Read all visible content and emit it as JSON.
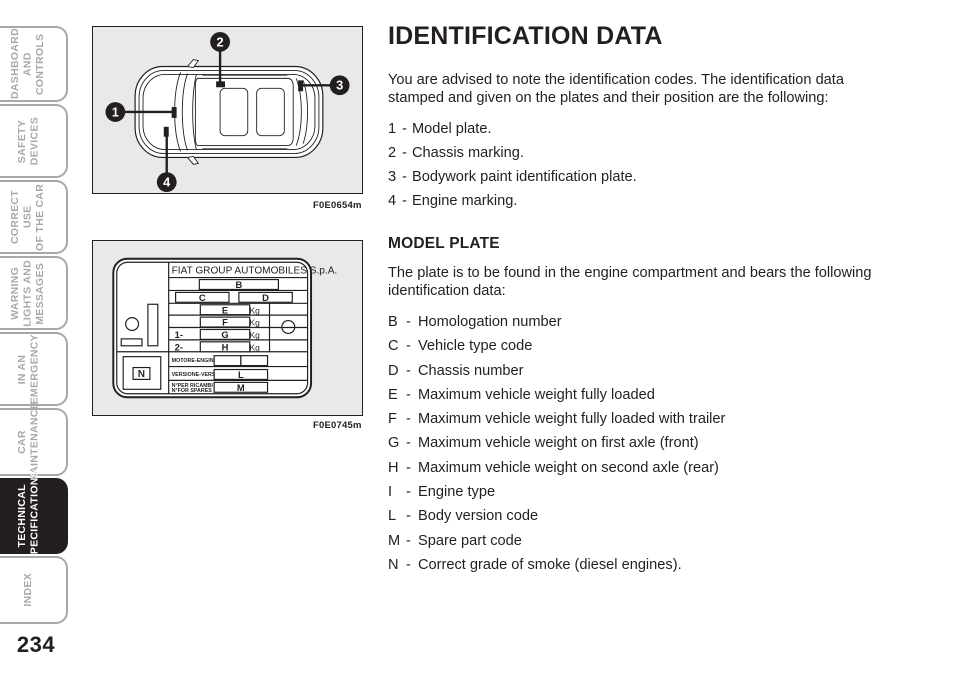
{
  "page": {
    "number": "234"
  },
  "sidebar": {
    "tabs": [
      {
        "label": "DASHBOARD\nAND CONTROLS",
        "active": false
      },
      {
        "label": "SAFETY\nDEVICES",
        "active": false
      },
      {
        "label": "CORRECT USE\nOF THE CAR",
        "active": false
      },
      {
        "label": "WARNING\nLIGHTS AND\nMESSAGES",
        "active": false
      },
      {
        "label": "IN AN\nEMERGENCY",
        "active": false
      },
      {
        "label": "CAR\nMAINTENANCE",
        "active": false
      },
      {
        "label": "TECHNICAL\nSPECIFICATIONS",
        "active": true
      },
      {
        "label": "INDEX",
        "active": false
      }
    ]
  },
  "figures": {
    "car": {
      "caption": "F0E0654m",
      "callouts": [
        {
          "number": "1"
        },
        {
          "number": "2"
        },
        {
          "number": "3"
        },
        {
          "number": "4"
        }
      ]
    },
    "plate": {
      "caption": "F0E0745m",
      "manufacturer": "FIAT GROUP AUTOMOBILES S.p.A.",
      "fields": {
        "b": "B",
        "c": "C",
        "d": "D",
        "e": "E",
        "f": "F",
        "g": "G",
        "h": "H",
        "l": "L",
        "m": "M",
        "n": "N"
      },
      "row_prefix_1": "1-",
      "row_prefix_2": "2-",
      "unit": "Kg",
      "label_engine": "MOTORE-ENGINE",
      "label_version": "VERSIONE-VERSION",
      "label_spares_line1": "N°PER RICAMBI",
      "label_spares_line2": "N°FOR SPARES"
    }
  },
  "content": {
    "title": "IDENTIFICATION DATA",
    "intro": "You are advised to note the identification codes. The identification data stamped and given on the plates and their position are the following:",
    "numbered_items": [
      {
        "key": "1",
        "dash": "-",
        "text": "Model plate."
      },
      {
        "key": "2",
        "dash": "-",
        "text": "Chassis marking."
      },
      {
        "key": "3",
        "dash": "-",
        "text": "Bodywork paint identification plate."
      },
      {
        "key": "4",
        "dash": "-",
        "text": "Engine marking."
      }
    ],
    "subtitle": "MODEL PLATE",
    "subtitle_intro": "The plate is to be found in the engine compartment and bears the following identification data:",
    "lettered_items": [
      {
        "key": "B",
        "dash": "-",
        "text": "Homologation number"
      },
      {
        "key": "C",
        "dash": "-",
        "text": "Vehicle type code"
      },
      {
        "key": "D",
        "dash": "-",
        "text": "Chassis number"
      },
      {
        "key": "E",
        "dash": "-",
        "text": "Maximum vehicle weight fully loaded"
      },
      {
        "key": "F",
        "dash": "-",
        "text": "Maximum vehicle weight fully loaded with trailer"
      },
      {
        "key": "G",
        "dash": "-",
        "text": "Maximum vehicle weight on first axle (front)"
      },
      {
        "key": "H",
        "dash": "-",
        "text": "Maximum vehicle weight on second axle (rear)"
      },
      {
        "key": "I",
        "dash": "-",
        "text": "Engine type"
      },
      {
        "key": "L",
        "dash": "-",
        "text": "Body version code"
      },
      {
        "key": "M",
        "dash": "-",
        "text": "Spare part code"
      },
      {
        "key": "N",
        "dash": "-",
        "text": "Correct grade of smoke (diesel engines)."
      }
    ]
  },
  "colors": {
    "ink": "#231f20",
    "tab_inactive_border": "#a6a8ab",
    "tab_active_bg": "#231f20",
    "figure_bg": "#e9e9e9"
  }
}
